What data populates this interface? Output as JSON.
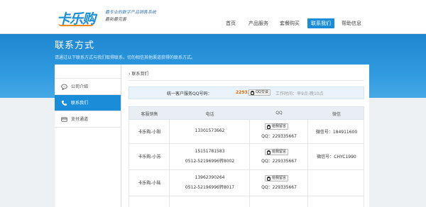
{
  "brand": {
    "logo_text": "卡乐购",
    "slogan_line1": "最专业的数字产品销售系统",
    "slogan_line2": "最新最完善"
  },
  "nav": {
    "items": [
      {
        "label": "首页",
        "active": false
      },
      {
        "label": "产品服务",
        "active": false
      },
      {
        "label": "套餐购买",
        "active": false
      },
      {
        "label": "联系我们",
        "active": true
      },
      {
        "label": "帮助信息",
        "active": false
      }
    ]
  },
  "banner": {
    "title": "联系方式",
    "subtitle": "请通过以下联系方式与我们取得联系，切勿相信其他渠道获得的联系方式。"
  },
  "sidebar": {
    "items": [
      {
        "label": "公司介绍",
        "icon": "chat-bubble-icon",
        "active": false
      },
      {
        "label": "联系我们",
        "icon": "phone-icon",
        "active": true
      },
      {
        "label": "支付通道",
        "icon": "card-icon",
        "active": false
      }
    ]
  },
  "content": {
    "breadcrumb": "联系我们",
    "service": {
      "label": "统一客户服务QQ号码：",
      "qq": "229335667",
      "button": "QQ交谈",
      "hours": "工作时间：早9点-晚10点"
    },
    "table": {
      "headers": [
        "客服销售",
        "电话",
        "QQ",
        "微信"
      ],
      "message_button": "给我留言",
      "rows": [
        {
          "name": "卡乐购-小阳",
          "phones": [
            "13301573662"
          ],
          "qq": "QQ：229335667",
          "wechat": "微信号：184911600"
        },
        {
          "name": "卡乐购-小苏",
          "phones": [
            "15151781583",
            "0512-52196996转8002"
          ],
          "qq": "QQ：229335667",
          "wechat": "微信号：CHYC1990"
        },
        {
          "name": "卡乐购-小陆",
          "phones": [
            "13962390264",
            "0512-52196996转8017"
          ],
          "qq": "QQ：229335667",
          "wechat": ""
        }
      ]
    }
  }
}
